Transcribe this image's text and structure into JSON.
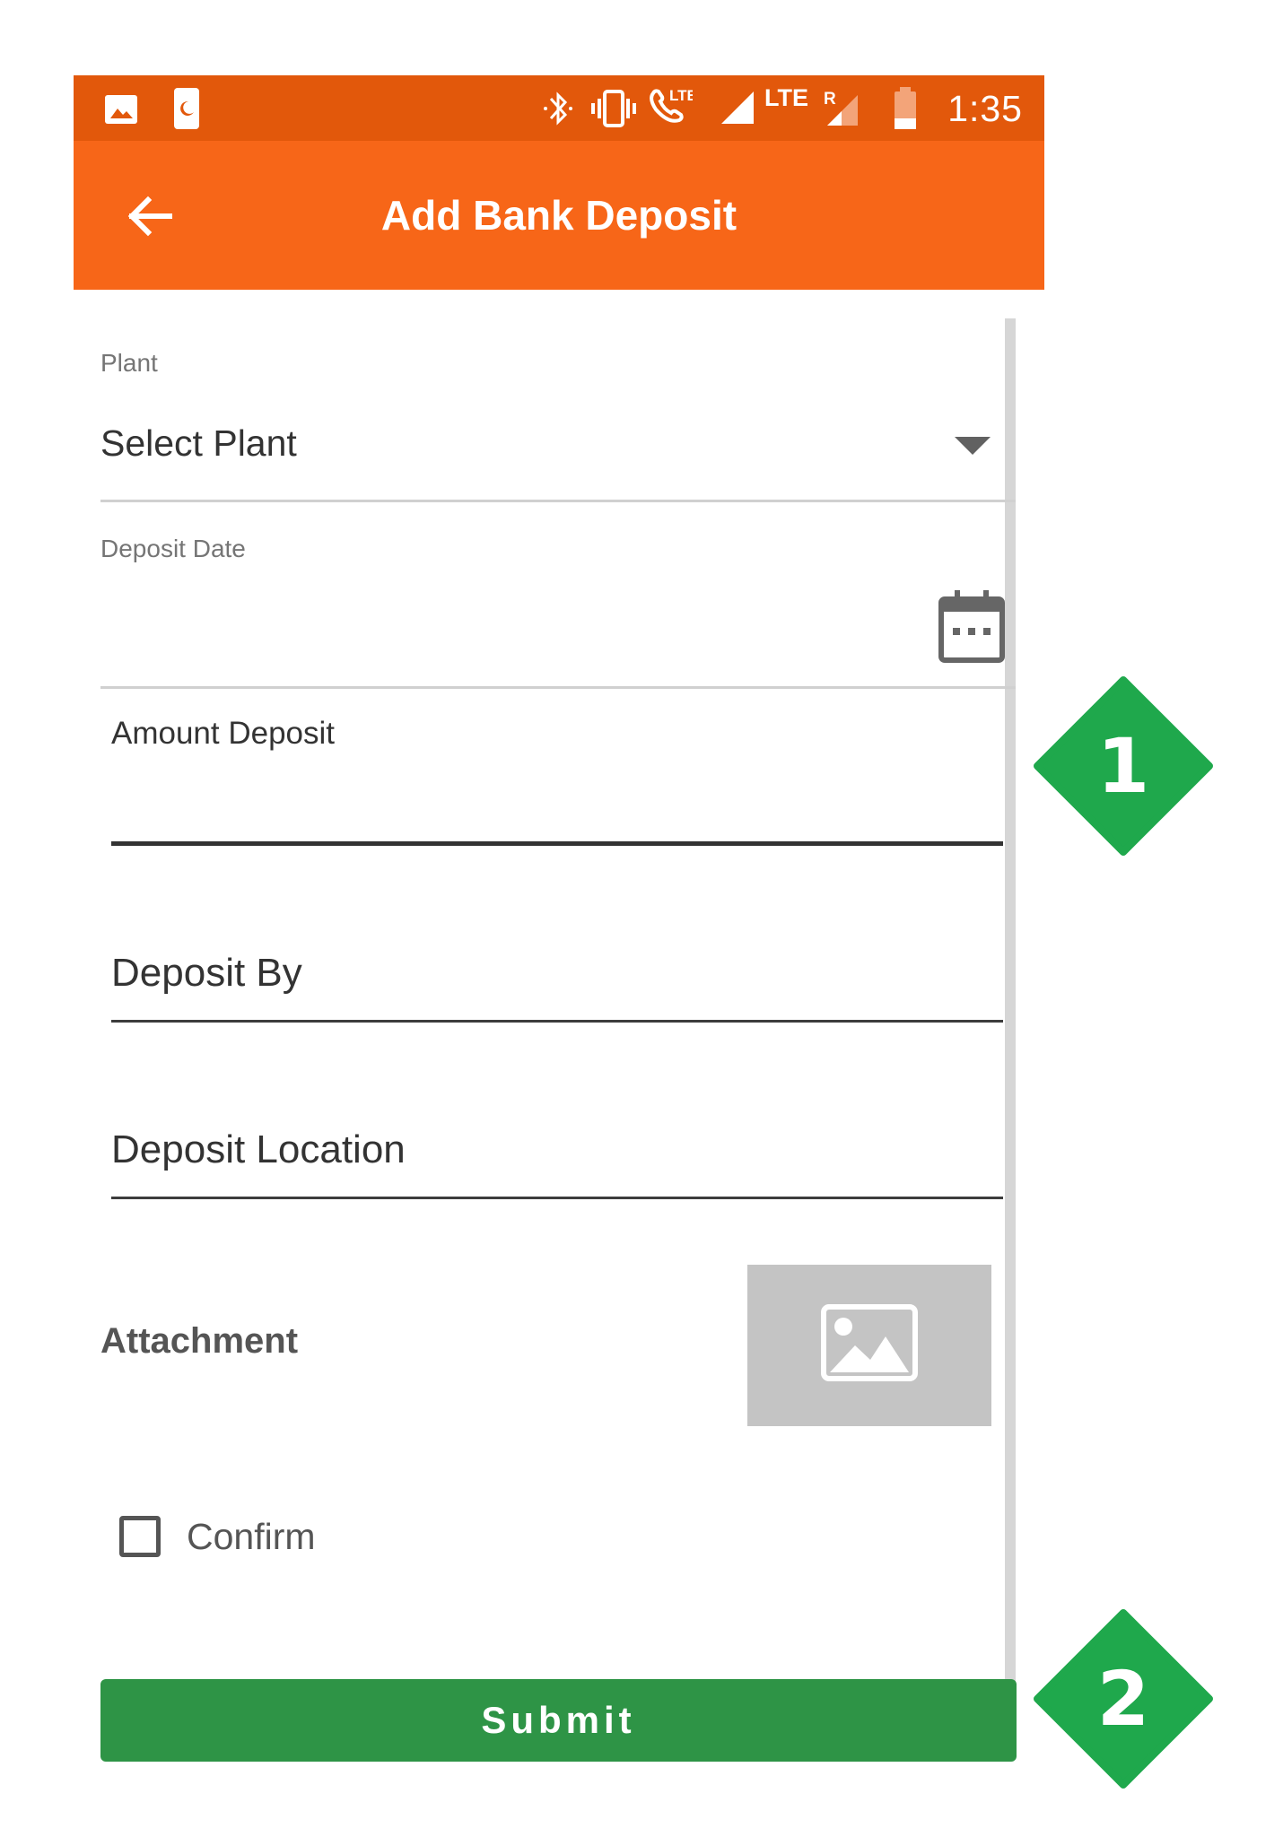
{
  "status_bar": {
    "time": "1:35",
    "network_1": "LTE",
    "network_2": "LTE",
    "roaming": "R",
    "icons": [
      "image-icon",
      "phone-night-icon",
      "bluetooth-icon",
      "vibrate-icon",
      "volte-call-icon",
      "signal-icon",
      "signal-roaming-icon",
      "battery-icon"
    ]
  },
  "app_bar": {
    "title": "Add Bank Deposit",
    "back_icon": "arrow-left-icon",
    "background": "#f76618"
  },
  "form": {
    "plant": {
      "label": "Plant",
      "value": "Select Plant"
    },
    "deposit_date": {
      "label": "Deposit Date",
      "value": "",
      "icon": "calendar-icon"
    },
    "amount_deposit": {
      "label": "Amount Deposit",
      "value": ""
    },
    "deposit_by": {
      "placeholder": "Deposit By"
    },
    "deposit_location": {
      "placeholder": "Deposit Location"
    },
    "attachment": {
      "label": "Attachment",
      "icon": "image-placeholder-icon"
    },
    "confirm": {
      "label": "Confirm",
      "checked": false
    },
    "submit_label": "Submit"
  },
  "annotations": [
    {
      "number": "1",
      "color": "#1fa84c"
    },
    {
      "number": "2",
      "color": "#1fa84c"
    }
  ]
}
